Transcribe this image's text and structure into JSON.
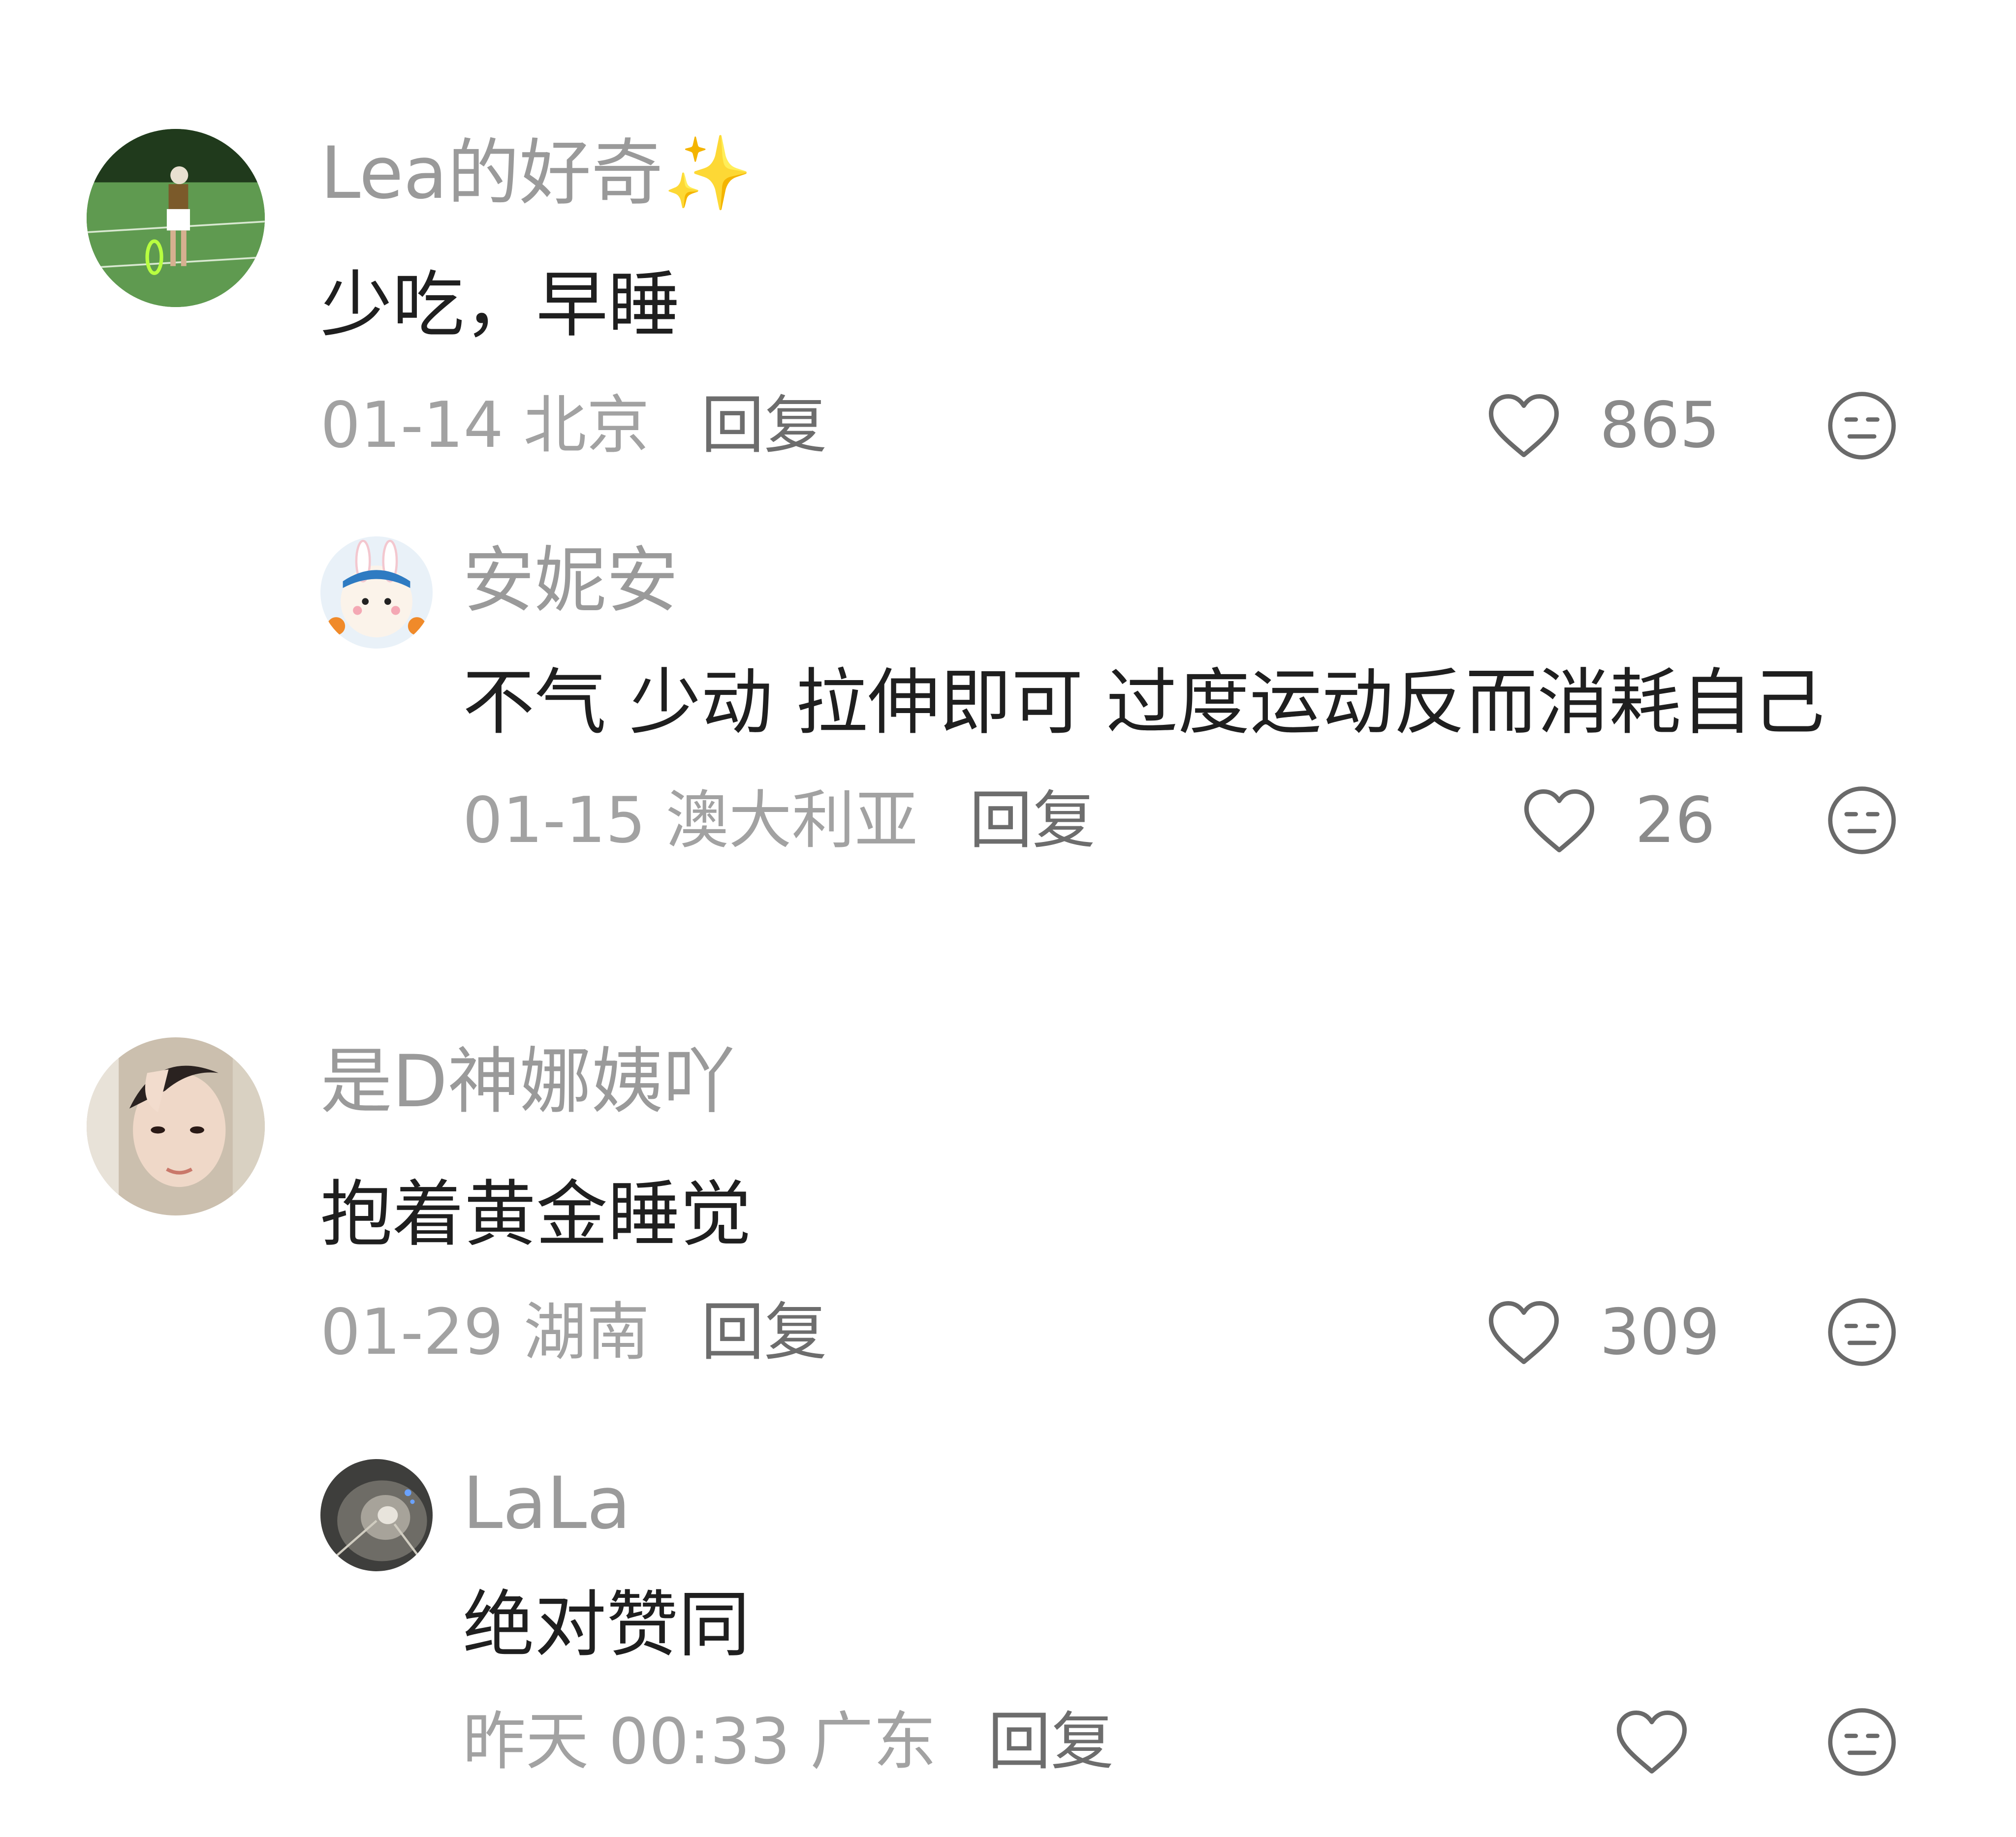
{
  "comments": [
    {
      "username": "Lea的好奇",
      "username_emoji": "✨",
      "text": "少吃，早睡",
      "date": "01-14",
      "location": "北京",
      "reply_label": "回复",
      "likes": "865",
      "avatar": "tennis-player-photo"
    },
    {
      "username": "安妮安",
      "text": "不气 少动 拉伸即可 过度运动反而消耗自己",
      "date": "01-15",
      "location": "澳大利亚",
      "reply_label": "回复",
      "likes": "26",
      "avatar": "bunny-plush-photo"
    },
    {
      "username": "是D神娜姨吖",
      "text": "抱着黄金睡觉",
      "date": "01-29",
      "location": "湖南",
      "reply_label": "回复",
      "likes": "309",
      "avatar": "selfie-photo"
    },
    {
      "username": "LaLa",
      "text": "绝对赞同",
      "date": "昨天 00:33",
      "location": "广东",
      "reply_label": "回复",
      "likes": "",
      "avatar": "tunnel-photo"
    }
  ],
  "icons": {
    "like": "heart-outline-icon",
    "dislike": "unamused-face-icon"
  },
  "colors": {
    "username": "#9a9a9a",
    "text": "#1f1f1f",
    "meta": "#a2a2a2",
    "icon": "#6a6a6a"
  }
}
